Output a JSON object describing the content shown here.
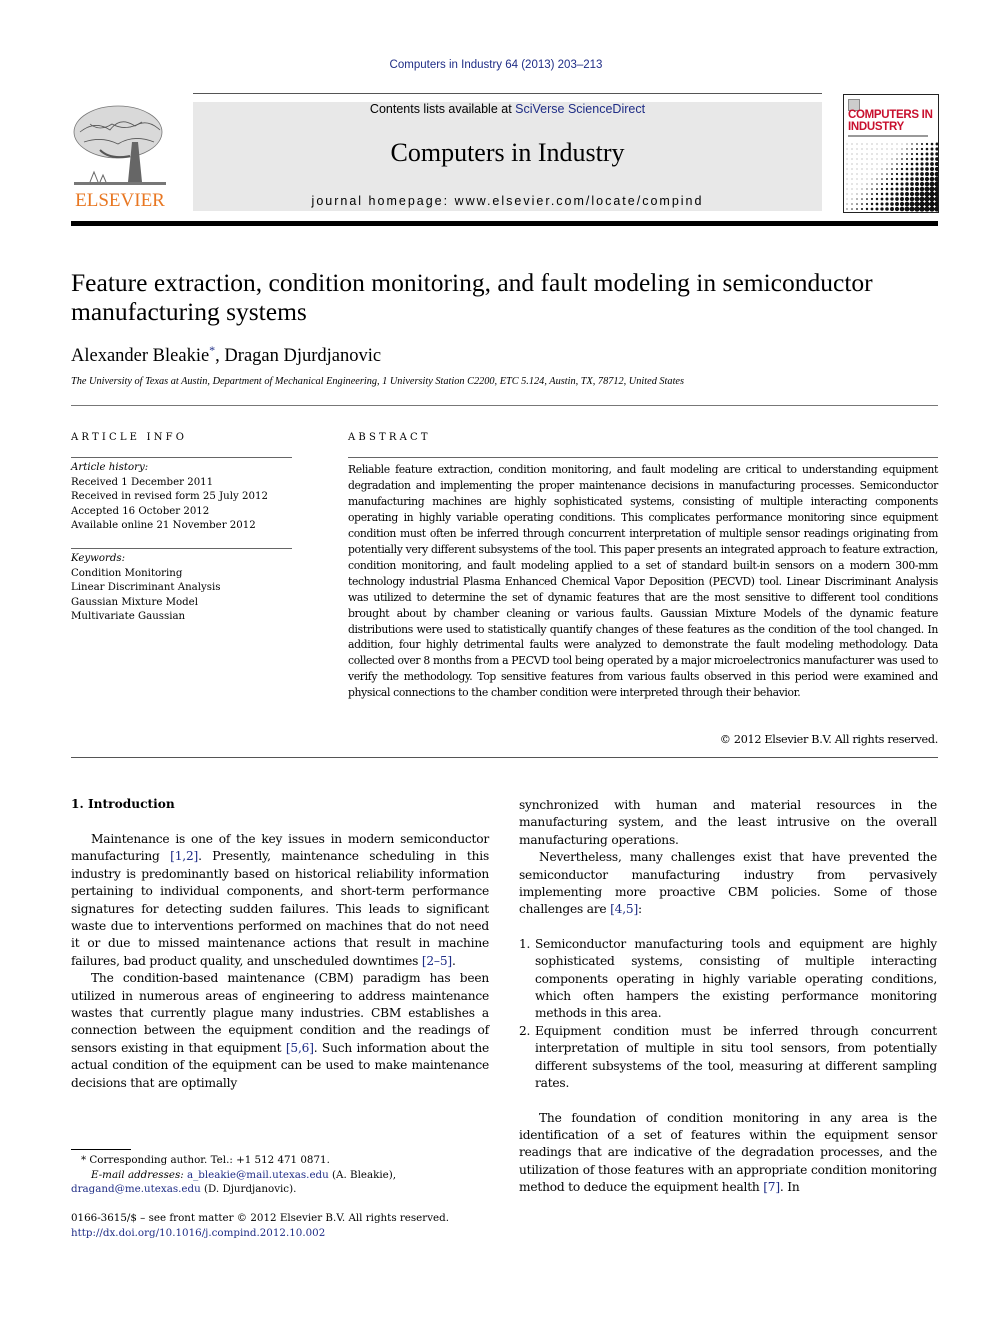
{
  "header": {
    "journal_ref": "Computers in Industry 64 (2013) 203–213",
    "contents_prefix": "Contents lists available at ",
    "contents_link": "SciVerse ScienceDirect",
    "journal_name": "Computers in Industry",
    "homepage": "journal homepage: www.elsevier.com/locate/compind",
    "publisher_wordmark": "ELSEVIER",
    "cover_title_line1": "COMPUTERS IN",
    "cover_title_line2": "INDUSTRY",
    "colors": {
      "elsevier_orange": "#e87722",
      "link_blue": "#1f2d86",
      "cover_red": "#c8102e",
      "masthead_gray": "#e8e8e8"
    }
  },
  "article": {
    "title": "Feature extraction, condition monitoring, and fault modeling in semiconductor manufacturing systems",
    "authors": [
      {
        "name": "Alexander Bleakie",
        "mark": "*"
      },
      {
        "name": "Dragan Djurdjanovic",
        "mark": ""
      }
    ],
    "author_separator": ", ",
    "affiliation": "The University of Texas at Austin, Department of Mechanical Engineering, 1 University Station C2200, ETC 5.124, Austin, TX, 78712, United States"
  },
  "article_info": {
    "label": "ARTICLE INFO",
    "history_label": "Article history:",
    "history": [
      "Received 1 December 2011",
      "Received in revised form 25 July 2012",
      "Accepted 16 October 2012",
      "Available online 21 November 2012"
    ],
    "keywords_label": "Keywords:",
    "keywords": [
      "Condition Monitoring",
      "Linear Discriminant Analysis",
      "Gaussian Mixture Model",
      "Multivariate Gaussian"
    ]
  },
  "abstract": {
    "label": "ABSTRACT",
    "text": "Reliable feature extraction, condition monitoring, and fault modeling are critical to understanding equipment degradation and implementing the proper maintenance decisions in manufacturing processes. Semiconductor manufacturing machines are highly sophisticated systems, consisting of multiple interacting components operating in highly variable operating conditions. This complicates performance monitoring since equipment condition must often be inferred through concurrent interpretation of multiple sensor readings originating from potentially very different subsystems of the tool. This paper presents an integrated approach to feature extraction, condition monitoring, and fault modeling applied to a set of standard built-in sensors on a modern 300-mm technology industrial Plasma Enhanced Chemical Vapor Deposition (PECVD) tool. Linear Discriminant Analysis was utilized to determine the set of dynamic features that are the most sensitive to different tool conditions brought about by chamber cleaning or various faults. Gaussian Mixture Models of the dynamic feature distributions were used to statistically quantify changes of these features as the condition of the tool changed. In addition, four highly detrimental faults were analyzed to demonstrate the fault modeling methodology. Data collected over 8 months from a PECVD tool being operated by a major microelectronics manufacturer was used to verify the methodology. Top sensitive features from various faults observed in this period were examined and physical connections to the chamber condition were interpreted through their behavior.",
    "copyright": "© 2012 Elsevier B.V. All rights reserved."
  },
  "body": {
    "section_heading": "1.  Introduction",
    "p1": {
      "a": "Maintenance is one of the key issues in modern semiconductor manufacturing ",
      "ref1": "[1,2]",
      "b": ". Presently, maintenance scheduling in this industry is predominantly based on historical reliability information pertaining to individual components, and short-term performance signatures for detecting sudden failures. This leads to significant waste due to interventions performed on machines that do not need it or due to missed maintenance actions that result in machine failures, bad product quality, and unscheduled downtimes ",
      "ref2": "[2–5]",
      "c": "."
    },
    "p2": {
      "a": "The condition-based maintenance (CBM) paradigm has been utilized in numerous areas of engineering to address maintenance wastes that currently plague many industries. CBM establishes a connection between the equipment condition and the readings of sensors existing in that equipment ",
      "ref1": "[5,6]",
      "b": ". Such information about the actual condition of the equipment can be used to make maintenance decisions that are optimally synchronized with human and material resources in the manufacturing system, and the least intrusive on the overall manufacturing operations."
    },
    "p3": {
      "a": "Nevertheless, many challenges exist that have prevented the semiconductor manufacturing industry from pervasively implementing more proactive CBM policies. Some of those challenges are ",
      "ref1": "[4,5]",
      "b": ":"
    },
    "list": [
      {
        "num": "1.",
        "text": "Semiconductor manufacturing tools and equipment are highly sophisticated systems, consisting of multiple interacting components operating in highly variable operating conditions, which often hampers the existing performance monitoring methods in this area."
      },
      {
        "num": "2.",
        "text": "Equipment condition must be inferred through concurrent interpretation of multiple in situ tool sensors, from potentially different subsystems of the tool, measuring at different sampling rates."
      }
    ],
    "p4": {
      "a": "The foundation of condition monitoring in any area is the identification of a set of features within the equipment sensor readings that are indicative of the degradation processes, and the utilization of those features with an appropriate condition monitoring method to deduce the equipment health ",
      "ref1": "[7]",
      "b": ". In"
    }
  },
  "footnotes": {
    "star": "*",
    "corresponding": " Corresponding author. Tel.: +1 512 471 0871.",
    "email_label": "E-mail addresses: ",
    "email1": "a_bleakie@mail.utexas.edu",
    "email1_owner": " (A. Bleakie),",
    "email2": "dragand@me.utexas.edu",
    "email2_owner": " (D. Djurdjanovic).",
    "front_matter": "0166-3615/$ – see front matter © 2012 Elsevier B.V. All rights reserved.",
    "doi": "http://dx.doi.org/10.1016/j.compind.2012.10.002"
  }
}
